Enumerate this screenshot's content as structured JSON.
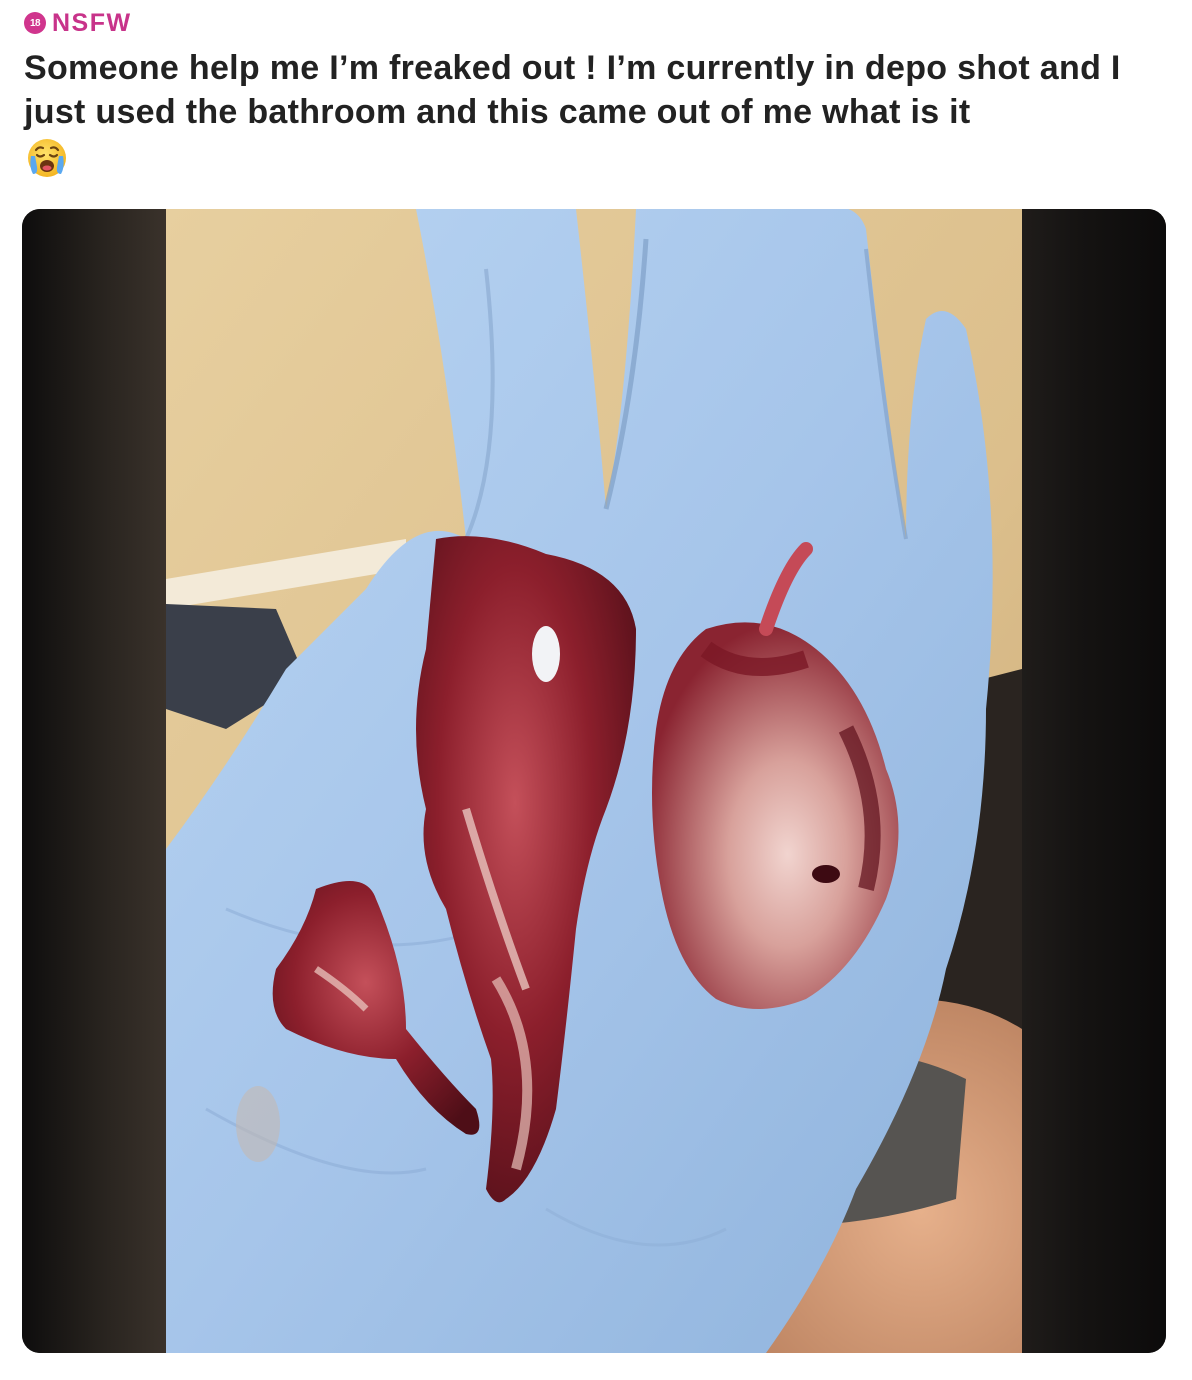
{
  "post": {
    "nsfw_badge_number": "18",
    "nsfw_label": "NSFW",
    "title": "Someone help me I’m freaked out ! I’m currently in depo shot and I just used the bathroom and this came out of me what is it",
    "title_emoji": "😭"
  },
  "media": {
    "icon": "photo-image",
    "colors": {
      "glove": "#9fc3ea",
      "wall": "#e3c99a",
      "tissue": "#7a1a22",
      "background_blur": "#0c0b0b"
    }
  }
}
